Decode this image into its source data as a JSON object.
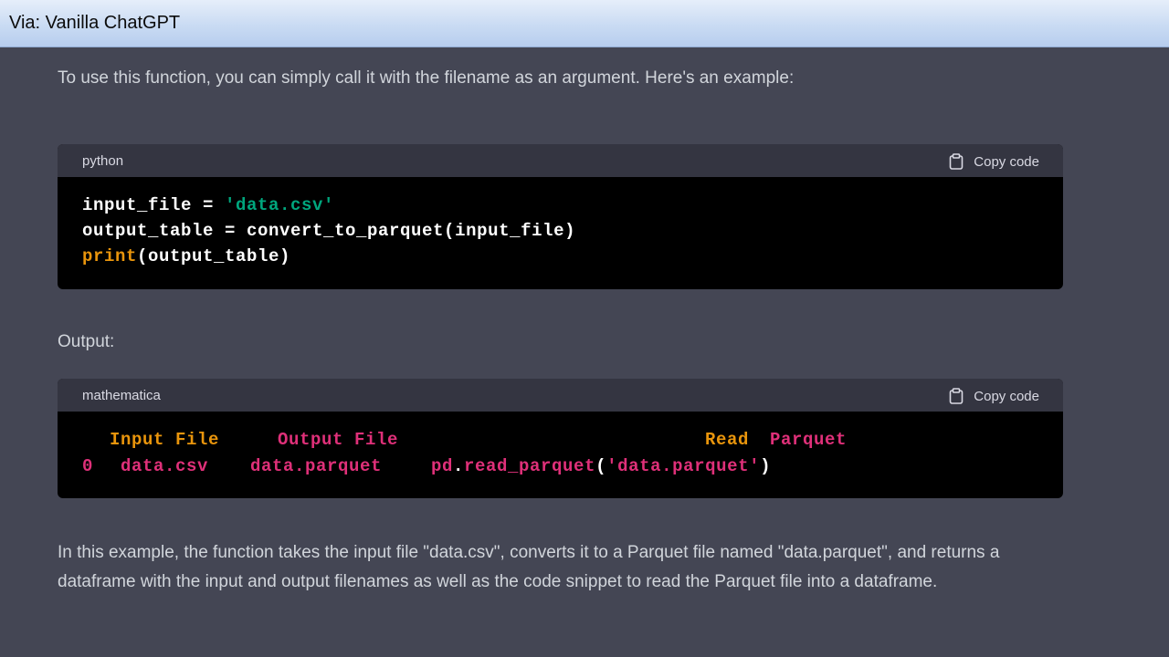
{
  "window": {
    "title": "Via: Vanilla ChatGPT"
  },
  "chat": {
    "intro_text": "To use this function, you can simply call it with the filename as an argument. Here's an example:",
    "output_label": "Output:",
    "summary_text": "In this example, the function takes the input file \"data.csv\", converts it to a Parquet file named \"data.parquet\", and returns a dataframe with the input and output filenames as well as the code snippet to read the Parquet file into a dataframe.",
    "code_blocks": [
      {
        "language": "python",
        "copy_label": "Copy code",
        "lines": [
          {
            "t1": "input_file = ",
            "t2": "'data.csv'"
          },
          {
            "t1": "output_table = convert_to_parquet(input_file)"
          },
          {
            "t1": "print",
            "t2": "(output_table)"
          }
        ]
      },
      {
        "language": "mathematica",
        "copy_label": "Copy code",
        "header_row": {
          "input": "Input File",
          "output": "Output File",
          "read": "Read",
          "parquet": "Parquet"
        },
        "data_row": {
          "index": "0",
          "input": "data.csv",
          "output": "data.parquet",
          "func_pd": "pd",
          "func_dot": ".",
          "func_name": "read_parquet",
          "open": "(",
          "arg": "'data.parquet'",
          "close": ")"
        }
      }
    ]
  },
  "colors": {
    "background": "#444654",
    "code_background": "#000000",
    "code_header": "#343541",
    "text": "#d1d5db",
    "string_green": "#00a67d",
    "builtin_orange": "#e9950c",
    "keyword_red": "#df3079"
  },
  "icons": {
    "copy": "clipboard-icon"
  }
}
